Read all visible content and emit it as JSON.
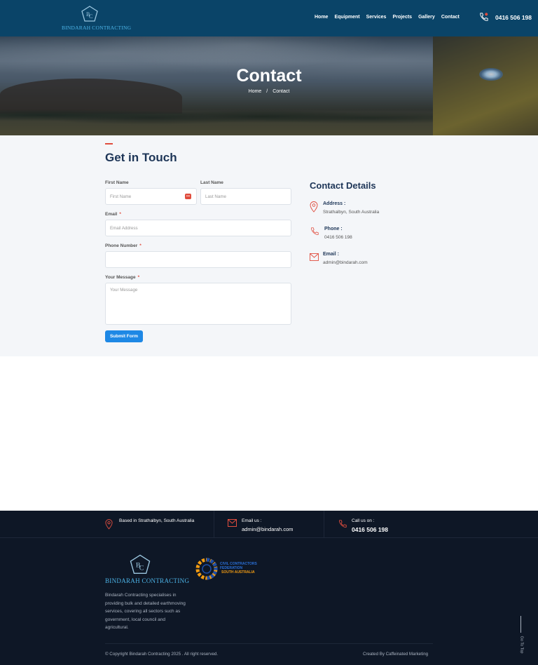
{
  "header": {
    "logo_text": "BINDARAH CONTRACTING",
    "nav": [
      "Home",
      "Equipment",
      "Services",
      "Projects",
      "Gallery",
      "Contact"
    ],
    "phone": "0416 506 198"
  },
  "hero": {
    "title": "Contact",
    "breadcrumb": {
      "home": "Home",
      "sep": "/",
      "current": "Contact"
    }
  },
  "form": {
    "heading": "Get in Touch",
    "first_name_label": "First Name",
    "first_name_placeholder": "First Name",
    "last_name_label": "Last Name",
    "last_name_placeholder": "Last Name",
    "email_label": "Email",
    "email_placeholder": "Email Address",
    "phone_label": "Phone Number",
    "phone_placeholder": "",
    "message_label": "Your Message",
    "message_placeholder": "Your Message",
    "required_mark": "*",
    "badge": "•••",
    "submit": "Submit Form"
  },
  "contact_details": {
    "heading": "Contact Details",
    "items": [
      {
        "icon": "location-pin-icon",
        "title": "Address :",
        "value": "Strathalbyn, South Australia"
      },
      {
        "icon": "phone-icon",
        "title": "Phone :",
        "value": "0416 506 198"
      },
      {
        "icon": "envelope-icon",
        "title": "Email :",
        "value": "admin@bindarah.com"
      }
    ]
  },
  "footer": {
    "top": [
      {
        "icon": "location-pin-icon",
        "small": "Based in Strathalbyn, South Australia",
        "big": ""
      },
      {
        "icon": "envelope-icon",
        "small": "Email us :",
        "big": "admin@bindarah.com"
      },
      {
        "icon": "phone-icon",
        "small": "Call us on :",
        "big": "0416 506 198"
      }
    ],
    "logo_text": "BINDARAH CONTRACTING",
    "partner": {
      "line1": "CIVIL CONTRACTORS",
      "line2": "FEDERATION",
      "line3": "SOUTH AUSTRALIA"
    },
    "description": "Bindarah Contracting specialises in providing bulk and detailed earthmoving services, covering all sectors such as government, local council and agricultural.",
    "copyright": "© Copyright Bindarah Contracting 2025 . All right reserved.",
    "credit": "Created By Caffeinated Marketing",
    "go_top": "Go To Top"
  },
  "colors": {
    "header_bg": "#0a4468",
    "accent": "#e04d3e",
    "button": "#1e88e5",
    "heading": "#1d3557",
    "footer_bg": "#0e1726",
    "logo_blue": "#4cb3e6"
  }
}
